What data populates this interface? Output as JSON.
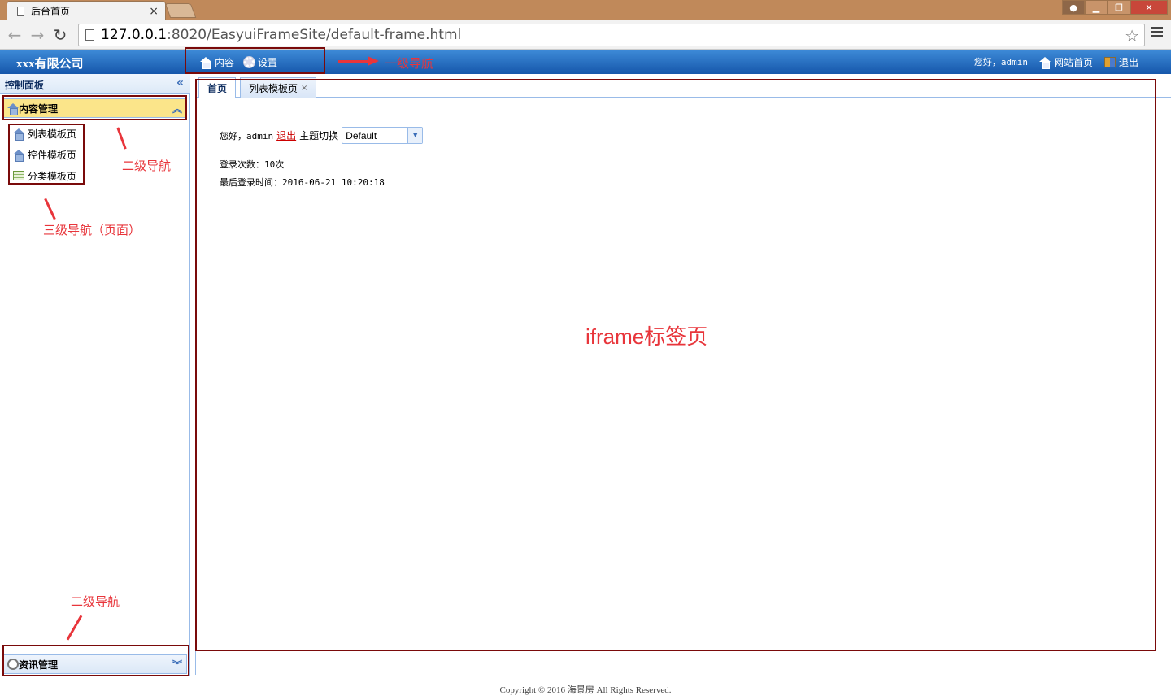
{
  "browser": {
    "tab_title": "后台首页",
    "tab_close": "×",
    "url_host": "127.0.0.1",
    "url_rest": ":8020/EasyuiFrameSite/default-frame.html",
    "back": "←",
    "forward": "→",
    "reload": "↻",
    "star": "☆",
    "window_min": "▁",
    "window_restore": "❐",
    "window_close": "✕"
  },
  "header": {
    "company": "xxx有限公司",
    "nav": [
      {
        "label": "内容",
        "icon": "home-icon"
      },
      {
        "label": "设置",
        "icon": "gear-icon"
      }
    ],
    "greeting": "您好，admin",
    "site_home": "网站首页",
    "logout": "退出"
  },
  "sidebar": {
    "panel_title": "控制面板",
    "collapse": "«",
    "groups": [
      {
        "label": "内容管理",
        "toggle": "︽",
        "items": [
          {
            "label": "列表模板页",
            "icon": "home-icon"
          },
          {
            "label": "控件模板页",
            "icon": "home-icon"
          },
          {
            "label": "分类模板页",
            "icon": "table-icon"
          }
        ]
      },
      {
        "label": "资讯管理",
        "toggle": "︾"
      }
    ]
  },
  "annotations": {
    "level1": "一级导航",
    "level2_top": "二级导航",
    "level3": "三级导航（页面）",
    "level2_bottom": "二级导航",
    "iframe": "iframe标签页"
  },
  "main": {
    "tabs": [
      {
        "label": "首页",
        "closable": false
      },
      {
        "label": "列表模板页",
        "closable": true
      }
    ],
    "tab_close": "×",
    "greeting_prefix": "您好，admin",
    "logout_link": "退出",
    "theme_label": "主题切换",
    "theme_value": "Default",
    "login_count": "登录次数：10次",
    "last_login": "最后登录时间：2016-06-21 10:20:18"
  },
  "footer": {
    "copyright": "Copyright © 2016 海景房 All Rights Reserved."
  },
  "colors": {
    "header_blue": "#1657ab",
    "annotation_red": "#e8353b",
    "box_red": "#7a0a0a",
    "accordion_active": "#fbe58a",
    "border_blue": "#99bbe8"
  }
}
